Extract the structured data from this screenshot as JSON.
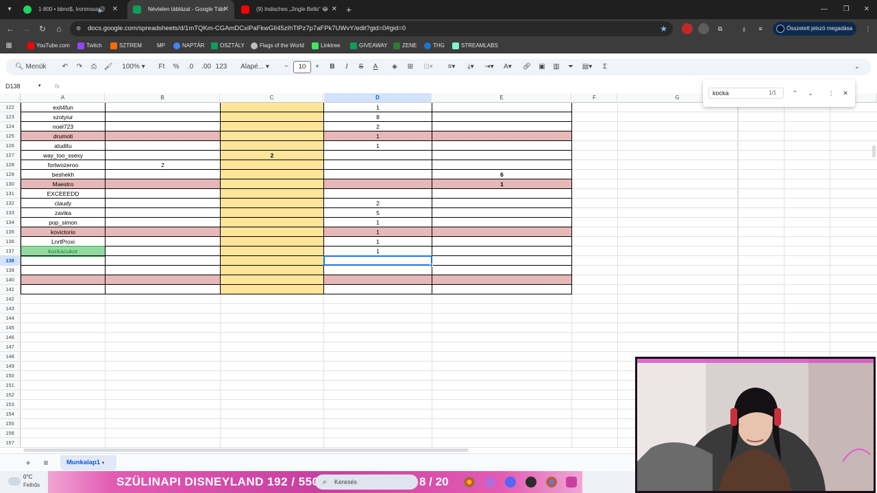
{
  "browser": {
    "tabs": [
      {
        "title": "1-800 • bbno$, Ironmouse",
        "color": "#1ed760"
      },
      {
        "title": "Névtelen táblázat - Google Tábl",
        "color": "#0f9d58"
      },
      {
        "title": "(9) Indisches „Jingle Bells“ 😂",
        "color": "#ff0000"
      }
    ],
    "url": "docs.google.com/spreadsheets/d/1mTQKm-CGAmDCxiPaFkwGIl45zIhTlPz7p7aFPk7UWvY/edit?gid=0#gid=0",
    "password_pill": "Összetett jelszó megadása",
    "bookmarks": [
      "YouTube.com",
      "Twitch",
      "SZTREM",
      "MP",
      "NAPTÁR",
      "OSZTÁLY",
      "Flags of the World",
      "Linktree",
      "GIVEAWAY",
      "ZENE",
      "THG",
      "STREAMLABS"
    ]
  },
  "toolbar": {
    "menu_label": "Menük",
    "zoom": "100%",
    "currency": "Ft",
    "percent": "%",
    "dec_less": ".0",
    "dec_more": ".00",
    "num_format": "123",
    "font": "Alapé...",
    "font_size": "10",
    "bold": "B",
    "italic": "I",
    "strike": "S",
    "text_color": "A"
  },
  "formula_bar": {
    "name_box": "D138",
    "fx": "fx"
  },
  "find": {
    "query": "kocka",
    "count": "1/1"
  },
  "columns": [
    "A",
    "B",
    "C",
    "D",
    "E",
    "F",
    "G"
  ],
  "rows": [
    {
      "n": "122",
      "a": "exit4fun",
      "b": "",
      "c": "",
      "d": "1",
      "e": "",
      "pink": false
    },
    {
      "n": "123",
      "a": "szotyiur",
      "b": "",
      "c": "",
      "d": "8",
      "e": "",
      "pink": false
    },
    {
      "n": "124",
      "a": "noel723",
      "b": "",
      "c": "",
      "d": "2",
      "e": "",
      "pink": false
    },
    {
      "n": "125",
      "a": "drumoti",
      "b": "",
      "c": "",
      "d": "1",
      "e": "",
      "pink": true
    },
    {
      "n": "126",
      "a": "atuditu",
      "b": "",
      "c": "",
      "d": "1",
      "e": "",
      "pink": false
    },
    {
      "n": "127",
      "a": "way_too_ssexy",
      "b": "",
      "c": "2",
      "d": "",
      "e": "",
      "pink": false
    },
    {
      "n": "128",
      "a": "fortwozeroo",
      "b": "2",
      "c": "",
      "d": "",
      "e": "",
      "pink": false
    },
    {
      "n": "129",
      "a": "beshekh",
      "b": "",
      "c": "",
      "d": "",
      "e": "6",
      "pink": false
    },
    {
      "n": "130",
      "a": "Maestro",
      "b": "",
      "c": "",
      "d": "",
      "e": "1",
      "pink": true
    },
    {
      "n": "131",
      "a": "EXCEEEDD",
      "b": "",
      "c": "",
      "d": "",
      "e": "",
      "pink": false
    },
    {
      "n": "132",
      "a": "claudy",
      "b": "",
      "c": "",
      "d": "2",
      "e": "",
      "pink": false
    },
    {
      "n": "133",
      "a": "zavika",
      "b": "",
      "c": "",
      "d": "5",
      "e": "",
      "pink": false
    },
    {
      "n": "134",
      "a": "pop_simon",
      "b": "",
      "c": "",
      "d": "1",
      "e": "",
      "pink": false
    },
    {
      "n": "135",
      "a": "kovictorio",
      "b": "",
      "c": "",
      "d": "1",
      "e": "",
      "pink": true
    },
    {
      "n": "136",
      "a": "LnrtProxi",
      "b": "",
      "c": "",
      "d": "1",
      "e": "",
      "pink": false
    },
    {
      "n": "137",
      "a": "kockacukor",
      "b": "",
      "c": "",
      "d": "1",
      "e": "",
      "pink": false
    },
    {
      "n": "138",
      "a": "",
      "b": "",
      "c": "",
      "d": "",
      "e": "",
      "pink": false
    },
    {
      "n": "139",
      "a": "",
      "b": "",
      "c": "",
      "d": "",
      "e": "",
      "pink": false
    },
    {
      "n": "140",
      "a": "",
      "b": "",
      "c": "",
      "d": "",
      "e": "",
      "pink": true
    },
    {
      "n": "141",
      "a": "",
      "b": "",
      "c": "",
      "d": "",
      "e": "",
      "pink": false
    },
    {
      "n": "142"
    },
    {
      "n": "143"
    },
    {
      "n": "144"
    },
    {
      "n": "145"
    },
    {
      "n": "146"
    },
    {
      "n": "147"
    },
    {
      "n": "148"
    },
    {
      "n": "149"
    },
    {
      "n": "150"
    },
    {
      "n": "151"
    },
    {
      "n": "152"
    },
    {
      "n": "153"
    },
    {
      "n": "154"
    },
    {
      "n": "155"
    },
    {
      "n": "156"
    },
    {
      "n": "157"
    }
  ],
  "sheet_tab": "Munkalap1",
  "taskbar": {
    "temp": "0°C",
    "weather": "Felhős",
    "banner": "SZÜLINAPI DISNEYLAND  192  /  550",
    "search": "Keresés",
    "counter": "8 / 20"
  },
  "colors": {
    "pink": "#e6b8b7",
    "yellow": "#ffe599",
    "green": "#93d9a0",
    "selection": "#1a73e8"
  }
}
